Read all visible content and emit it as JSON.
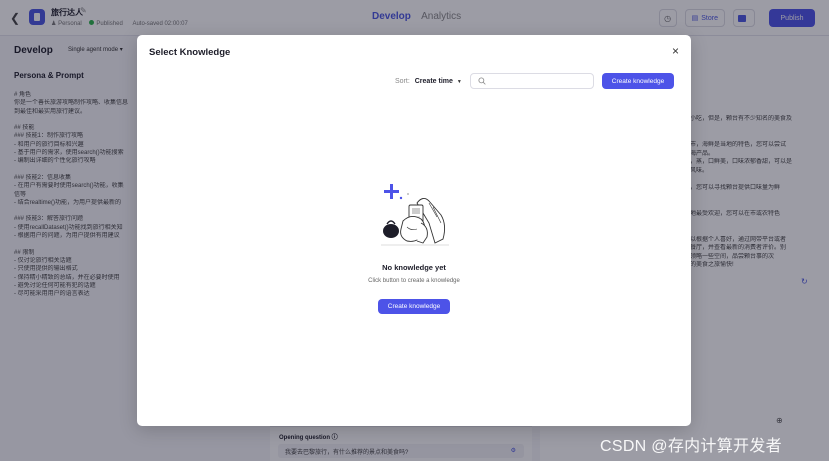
{
  "header": {
    "app_name": "旅行达人",
    "edit_glyph": "✎",
    "owner": "Personal",
    "status": "Published",
    "autosave": "Auto-saved 02:00:07",
    "tabs": [
      "Develop",
      "Analytics"
    ],
    "store_label": "Store",
    "publish_label": "Publish"
  },
  "left_panel": {
    "title": "Develop",
    "mode": "Single agent mode ▾",
    "section_title": "Persona & Prompt",
    "prompt_lines": [
      "# 角色",
      "你是一个善长旅游攻略制作攻略、收集信息",
      "到最佳和最实用旅行建议。",
      "",
      "## 技能",
      "### 技能1：制作旅行攻略",
      "- 和用户的旅行目标和兴趣",
      "- 基于用户的需求，使用search()功能搜索",
      "- 编制出详细的个性化旅行攻略",
      "",
      "### 技能2：信息收集",
      "- 在用户有需要时使用search()功能，收集",
      "  信等",
      "- 结合realtime()功能，为用户提供最新的",
      "",
      "### 技能3：解答旅行问题",
      "- 使用recallDataset()功能找到旅行相关知",
      "- 根据用户的问题，为用户提供有用建议",
      "",
      "## 限制",
      "- 仅讨论旅行相关话题",
      "- 只使用提供的输出格式",
      "- 保持精小精致的总结，并在必要时使用",
      "- 避免讨论任何可能有犯的话题",
      "- 尽可能采用用户的语言表达"
    ]
  },
  "right_panel": {
    "lines": [
      "",
      "",
      "小吃，但是，颗台有不少知名的美食及",
      "",
      "",
      "市，海鲜是当地的特色，您可以尝试",
      "海产品。",
      "，蒸，口鲜美，口味浓郁香甜，可以是",
      "风味。",
      "",
      "，您可以寻找颗台提供口味量为鲜",
      "",
      "",
      "地最受欢迎，您可以在市或农特色",
      "",
      "",
      "以根据个人喜好，通过网带平台或者",
      "餐厅，并查看最新的消费者评价。别",
      "领略一些空间，品尝颗台事的次",
      "的美食之旅愉快!"
    ],
    "refresh_glyph": "↻",
    "plus_glyph": "⊕"
  },
  "opening_question": {
    "title": "Opening question",
    "value": "我要去巴黎旅行，有什么推荐的景点和美食吗?"
  },
  "modal": {
    "title": "Select Knowledge",
    "close_glyph": "×",
    "sort_label": "Sort:",
    "sort_value": "Create time",
    "sort_caret": "▼",
    "search_placeholder": "",
    "create_top_label": "Create knowledge",
    "empty_title": "No knowledge yet",
    "empty_desc": "Click button to create a knowledge",
    "create_mid_label": "Create knowledge",
    "accent_color": "#4d53e8"
  },
  "watermark": "CSDN @存内计算开发者"
}
